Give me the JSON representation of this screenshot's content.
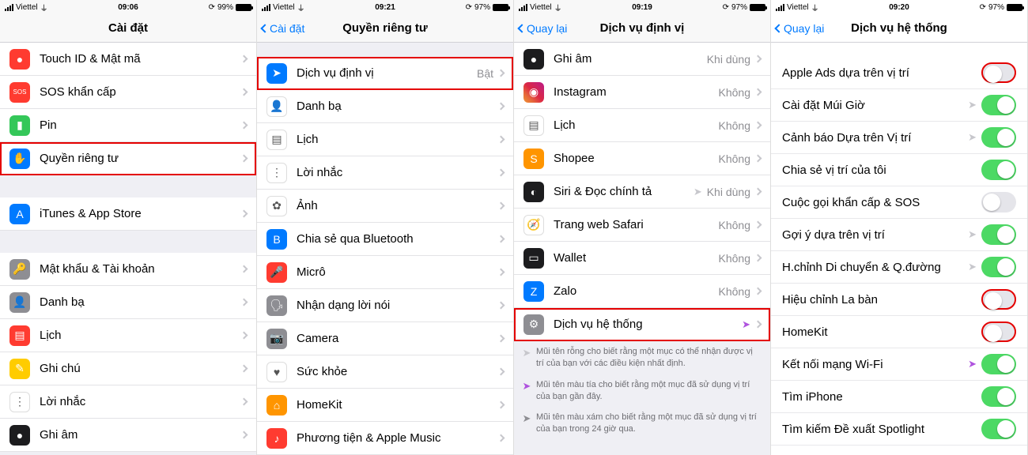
{
  "p1": {
    "status": {
      "carrier": "Viettel",
      "time": "09:06",
      "battery": "99%"
    },
    "title": "Cài đặt",
    "rows1": [
      {
        "name": "touchid",
        "label": "Touch ID & Mật mã",
        "iconColor": "ic-red",
        "glyph": "●"
      },
      {
        "name": "sos",
        "label": "SOS khẩn cấp",
        "iconColor": "ic-red",
        "glyph": "SOS",
        "small": true
      },
      {
        "name": "battery",
        "label": "Pin",
        "iconColor": "ic-green",
        "glyph": "▮"
      },
      {
        "name": "privacy",
        "label": "Quyền riêng tư",
        "iconColor": "ic-blue",
        "glyph": "✋",
        "hl": true
      }
    ],
    "rows2": [
      {
        "name": "appstore",
        "label": "iTunes & App Store",
        "iconColor": "ic-blue",
        "glyph": "A"
      }
    ],
    "rows3": [
      {
        "name": "passwords",
        "label": "Mật khẩu & Tài khoản",
        "iconColor": "ic-gray",
        "glyph": "🔑"
      },
      {
        "name": "contacts",
        "label": "Danh bạ",
        "iconColor": "ic-gray",
        "glyph": "👤"
      },
      {
        "name": "calendar",
        "label": "Lịch",
        "iconColor": "ic-red",
        "glyph": "▤"
      },
      {
        "name": "notes",
        "label": "Ghi chú",
        "iconColor": "ic-yellow",
        "glyph": "✎"
      },
      {
        "name": "reminders",
        "label": "Lời nhắc",
        "iconColor": "ic-white",
        "glyph": "⋮"
      },
      {
        "name": "voicememos",
        "label": "Ghi âm",
        "iconColor": "ic-black",
        "glyph": "●"
      }
    ]
  },
  "p2": {
    "status": {
      "carrier": "Viettel",
      "time": "09:21",
      "battery": "97%"
    },
    "back": "Cài đặt",
    "title": "Quyền riêng tư",
    "rows": [
      {
        "name": "location",
        "label": "Dịch vụ định vị",
        "value": "Bật",
        "iconColor": "ic-blue",
        "glyph": "➤",
        "hl": true
      },
      {
        "name": "contacts",
        "label": "Danh bạ",
        "iconColor": "ic-white",
        "glyph": "👤"
      },
      {
        "name": "calendar",
        "label": "Lịch",
        "iconColor": "ic-white",
        "glyph": "▤"
      },
      {
        "name": "reminders",
        "label": "Lời nhắc",
        "iconColor": "ic-white",
        "glyph": "⋮"
      },
      {
        "name": "photos",
        "label": "Ảnh",
        "iconColor": "ic-white",
        "glyph": "✿"
      },
      {
        "name": "bluetooth",
        "label": "Chia sẻ qua Bluetooth",
        "iconColor": "ic-blue",
        "glyph": "B"
      },
      {
        "name": "microphone",
        "label": "Micrô",
        "iconColor": "ic-red",
        "glyph": "🎤"
      },
      {
        "name": "speech",
        "label": "Nhận dạng lời nói",
        "iconColor": "ic-gray",
        "glyph": "🗣"
      },
      {
        "name": "camera",
        "label": "Camera",
        "iconColor": "ic-gray",
        "glyph": "📷"
      },
      {
        "name": "health",
        "label": "Sức khỏe",
        "iconColor": "ic-white",
        "glyph": "♥"
      },
      {
        "name": "homekit",
        "label": "HomeKit",
        "iconColor": "ic-orange",
        "glyph": "⌂"
      },
      {
        "name": "media",
        "label": "Phương tiện & Apple Music",
        "iconColor": "ic-red",
        "glyph": "♪"
      }
    ]
  },
  "p3": {
    "status": {
      "carrier": "Viettel",
      "time": "09:19",
      "battery": "97%"
    },
    "back": "Quay lại",
    "title": "Dịch vụ định vị",
    "rows": [
      {
        "name": "voicememos",
        "label": "Ghi âm",
        "value": "Khi dùng",
        "iconColor": "ic-black",
        "glyph": "●"
      },
      {
        "name": "instagram",
        "label": "Instagram",
        "value": "Không",
        "iconColor": "ic-gradient1",
        "glyph": "◉"
      },
      {
        "name": "calendar",
        "label": "Lịch",
        "value": "Không",
        "iconColor": "ic-white",
        "glyph": "▤"
      },
      {
        "name": "shopee",
        "label": "Shopee",
        "value": "Không",
        "iconColor": "ic-orange",
        "glyph": "S"
      },
      {
        "name": "siri",
        "label": "Siri & Đọc chính tả",
        "value": "Khi dùng",
        "arrow": "outline",
        "iconColor": "ic-black",
        "glyph": "◐"
      },
      {
        "name": "safari",
        "label": "Trang web Safari",
        "value": "Không",
        "iconColor": "ic-white",
        "glyph": "🧭"
      },
      {
        "name": "wallet",
        "label": "Wallet",
        "value": "Không",
        "iconColor": "ic-black",
        "glyph": "▭"
      },
      {
        "name": "zalo",
        "label": "Zalo",
        "value": "Không",
        "iconColor": "ic-blue",
        "glyph": "Z"
      },
      {
        "name": "system",
        "label": "Dịch vụ hệ thống",
        "arrow": "purple",
        "iconColor": "ic-gray",
        "glyph": "⚙",
        "hl": true
      }
    ],
    "notes": [
      {
        "arrow": "outline",
        "text": "Mũi tên rỗng cho biết rằng một mục có thể nhận được vị trí của bạn với các điều kiện nhất định."
      },
      {
        "arrow": "purple",
        "text": "Mũi tên màu tía cho biết rằng một mục đã sử dụng vị trí của bạn gần đây."
      },
      {
        "arrow": "gray",
        "text": "Mũi tên màu xám cho biết rằng một mục đã sử dụng vị trí của bạn trong 24 giờ qua."
      }
    ]
  },
  "p4": {
    "status": {
      "carrier": "Viettel",
      "time": "09:20",
      "battery": "97%"
    },
    "back": "Quay lại",
    "title": "Dịch vụ hệ thống",
    "rows": [
      {
        "name": "apple-ads",
        "label": "Apple Ads dựa trên vị trí",
        "on": false,
        "hl": true
      },
      {
        "name": "timezone",
        "label": "Cài đặt Múi Giờ",
        "on": true,
        "arrow": "outline"
      },
      {
        "name": "loc-alerts",
        "label": "Cảnh báo Dựa trên Vị trí",
        "on": true,
        "arrow": "outline"
      },
      {
        "name": "share-loc",
        "label": "Chia sẻ vị trí của tôi",
        "on": true
      },
      {
        "name": "emergency",
        "label": "Cuộc gọi khẩn cấp & SOS",
        "on": false
      },
      {
        "name": "loc-suggest",
        "label": "Gợi ý dựa trên vị trí",
        "on": true,
        "arrow": "outline"
      },
      {
        "name": "motion-cal",
        "label": "H.chỉnh Di chuyển & Q.đường",
        "on": true,
        "arrow": "outline"
      },
      {
        "name": "compass-cal",
        "label": "Hiệu chỉnh La bàn",
        "on": false,
        "hl": true
      },
      {
        "name": "homekit",
        "label": "HomeKit",
        "on": false,
        "hl": true
      },
      {
        "name": "wifi-net",
        "label": "Kết nối mạng Wi-Fi",
        "on": true,
        "arrow": "purple"
      },
      {
        "name": "find-iphone",
        "label": "Tìm iPhone",
        "on": true
      },
      {
        "name": "spotlight-sug",
        "label": "Tìm kiếm Đề xuất Spotlight",
        "on": true
      }
    ]
  }
}
